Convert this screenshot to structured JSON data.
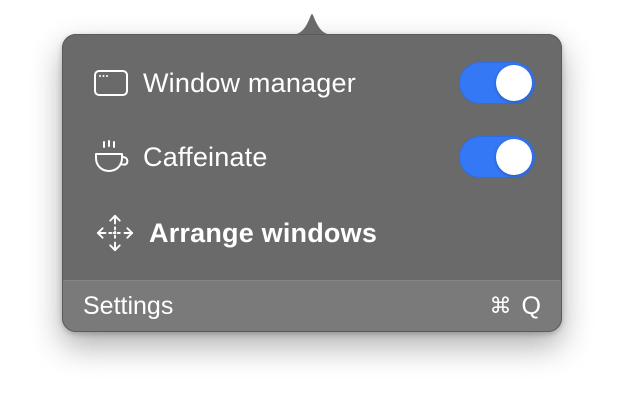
{
  "menu": {
    "items": [
      {
        "label": "Window manager",
        "icon": "window-icon",
        "toggle": true
      },
      {
        "label": "Caffeinate",
        "icon": "coffee-cup-icon",
        "toggle": true
      },
      {
        "label": "Arrange windows",
        "icon": "move-arrows-icon"
      }
    ]
  },
  "footer": {
    "settings_label": "Settings",
    "shortcut_symbol": "⌘",
    "shortcut_key": "Q"
  },
  "colors": {
    "panel": "#6a6a6a",
    "footer": "#7a7a7a",
    "toggle_on": "#3478f6",
    "text": "#ffffff"
  }
}
